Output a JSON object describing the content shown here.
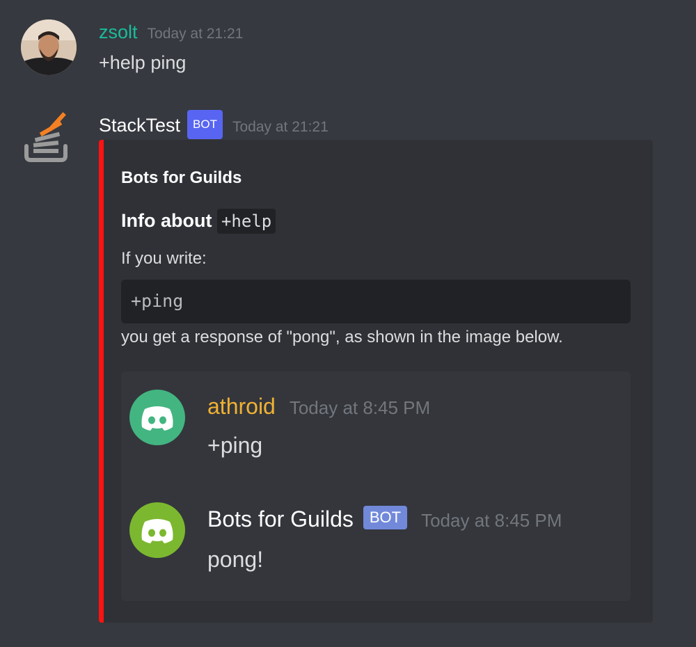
{
  "messages": [
    {
      "author": "zsolt",
      "author_color": "#1abc9c",
      "timestamp": "Today at 21:21",
      "text": "+help ping"
    },
    {
      "author": "StackTest",
      "author_color": "#ffffff",
      "bot_tag": "BOT",
      "timestamp": "Today at 21:21"
    }
  ],
  "embed": {
    "accent_color": "#ff1212",
    "author": "Bots for Guilds",
    "title_prefix": "Info about",
    "title_code": "+help",
    "desc_line1": "If you write:",
    "code": "+ping",
    "desc_line2": "you get a response of \"pong\", as shown in the image below.",
    "image": {
      "messages": [
        {
          "author": "athroid",
          "author_color": "#f0b232",
          "avatar_color": "#43b581",
          "avatar_icon": "discord-logo-icon",
          "timestamp": "Today at 8:45 PM",
          "text": "+ping"
        },
        {
          "author": "Bots for Guilds",
          "author_color": "#ffffff",
          "avatar_color": "#7cb82f",
          "avatar_icon": "discord-logo-icon",
          "bot_tag": "BOT",
          "timestamp": "Today at 8:45 PM",
          "text": "pong!"
        }
      ]
    }
  }
}
